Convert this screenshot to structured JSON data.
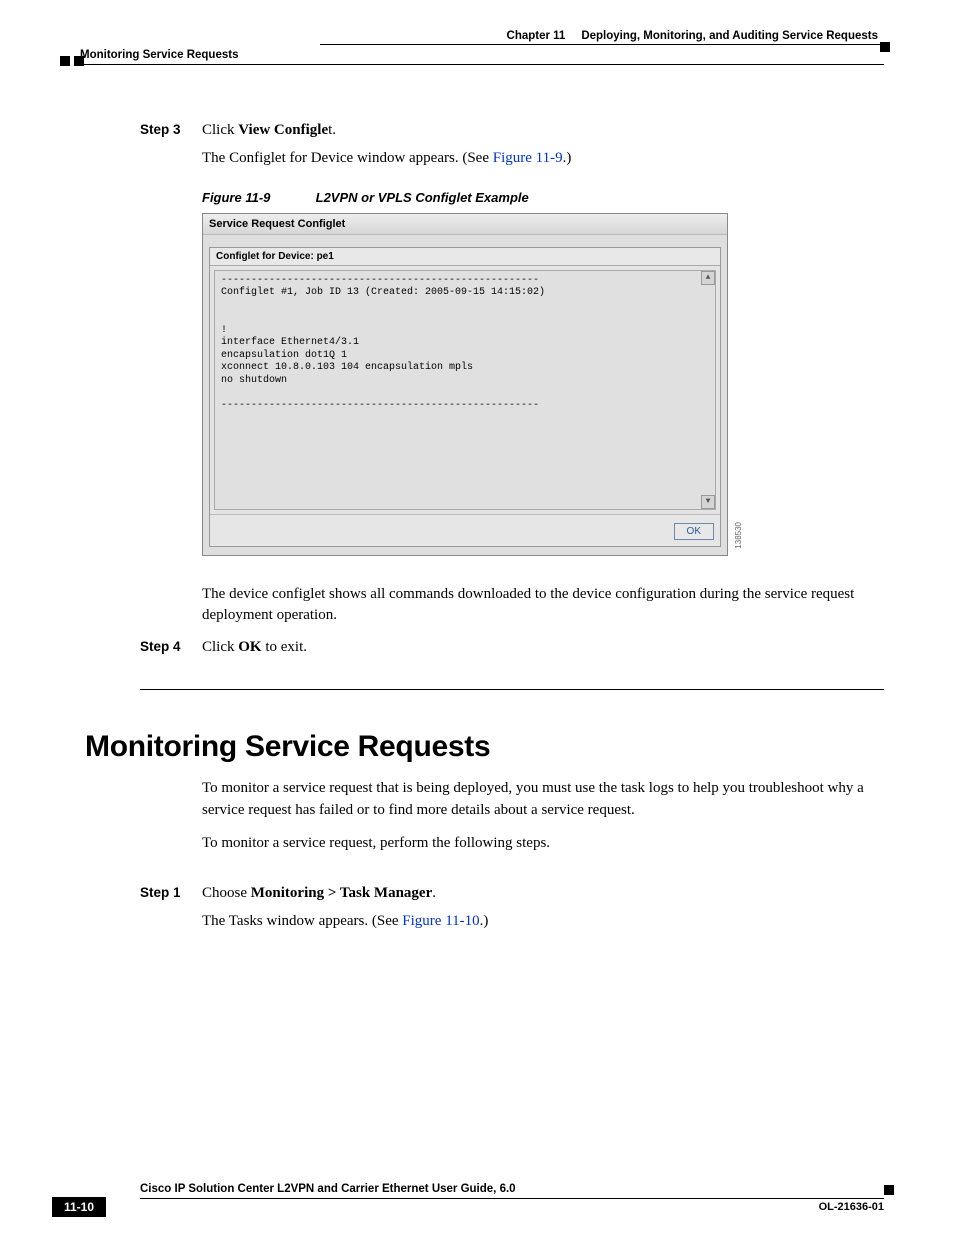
{
  "header": {
    "chapter_label": "Chapter 11",
    "chapter_title": "Deploying, Monitoring, and Auditing Service Requests",
    "section_breadcrumb": "Monitoring Service Requests"
  },
  "step3": {
    "label": "Step 3",
    "line1_prefix": "Click ",
    "line1_bold": "View Configle",
    "line1_suffix": "t.",
    "line2_prefix": "The Configlet for Device window appears. (See ",
    "line2_link": "Figure 11-9",
    "line2_suffix": ".)"
  },
  "figure": {
    "caption_num": "Figure 11-9",
    "caption_title": "L2VPN or VPLS Configlet Example",
    "window_title": "Service Request Configlet",
    "sub_header": "Configlet for Device: pe1",
    "content": "-----------------------------------------------------\nConfiglet #1, Job ID 13 (Created: 2005-09-15 14:15:02)\n\n\n!\ninterface Ethernet4/3.1\nencapsulation dot1Q 1\nxconnect 10.8.0.103 104 encapsulation mpls\nno shutdown\n\n-----------------------------------------------------",
    "ok_label": "OK",
    "image_id": "138530"
  },
  "post_figure": {
    "para": "The device configlet shows all commands downloaded to the device configuration during the service request deployment operation."
  },
  "step4": {
    "label": "Step 4",
    "line1_prefix": "Click ",
    "line1_bold": "OK",
    "line1_suffix": " to exit."
  },
  "section": {
    "title": "Monitoring Service Requests",
    "para1": "To monitor a service request that is being deployed, you must use the task logs to help you troubleshoot why a service request has failed or to find more details about a service request.",
    "para2": "To monitor a service request, perform the following steps."
  },
  "step1": {
    "label": "Step 1",
    "line1_prefix": "Choose ",
    "line1_bold": "Monitoring > Task Manager",
    "line1_suffix": ".",
    "line2_prefix": "The Tasks window appears. (See ",
    "line2_link": "Figure 11-10",
    "line2_suffix": ".)"
  },
  "footer": {
    "book_title": "Cisco IP Solution Center L2VPN and Carrier Ethernet User Guide, 6.0",
    "page_num": "11-10",
    "doc_id": "OL-21636-01"
  }
}
